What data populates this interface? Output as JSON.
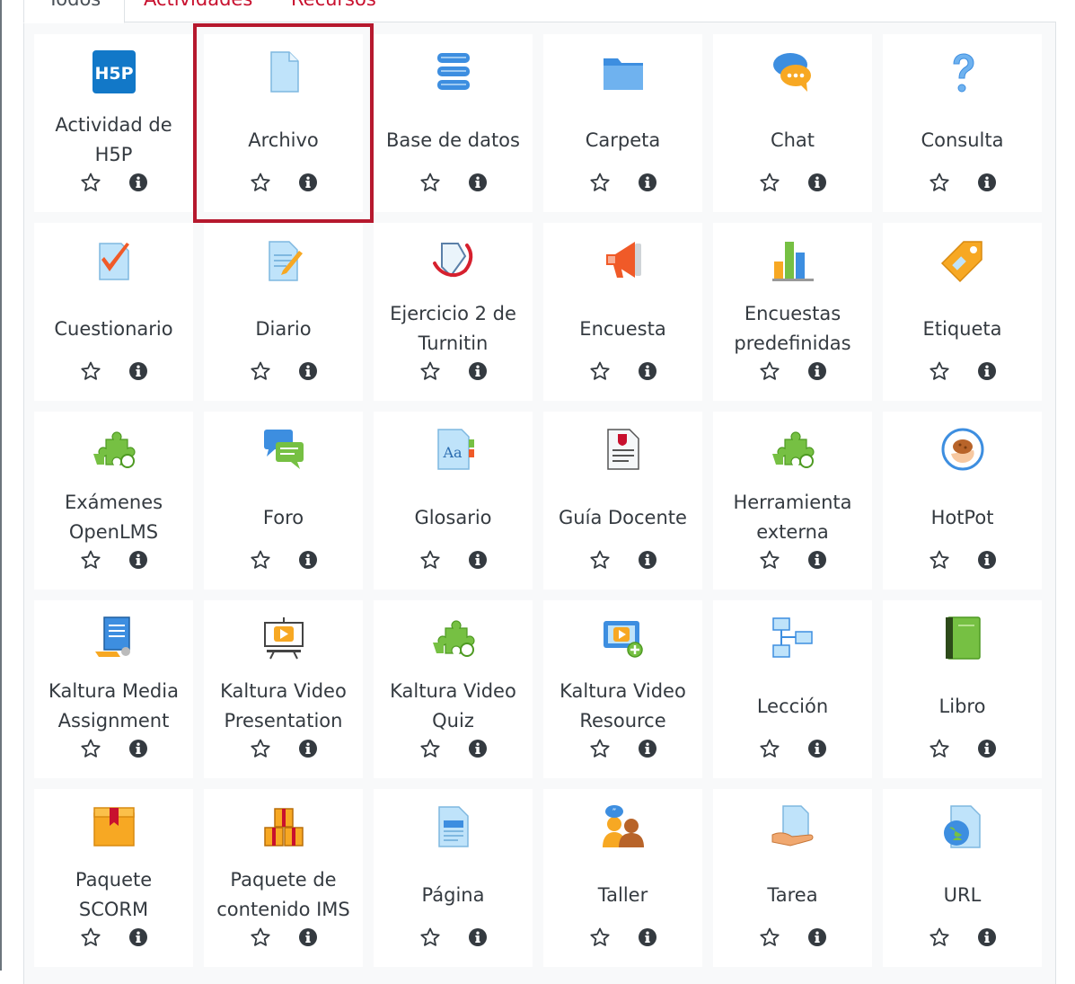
{
  "tabs": [
    {
      "label": "Todos",
      "active": true
    },
    {
      "label": "Actividades",
      "active": false
    },
    {
      "label": "Recursos",
      "active": false
    }
  ],
  "colors": {
    "accent": "#c8102e",
    "selection": "#b6192e",
    "text": "#343a40"
  },
  "items": [
    {
      "label": "Actividad de H5P",
      "icon": "h5p-icon",
      "selected": false
    },
    {
      "label": "Archivo",
      "icon": "file-icon",
      "selected": true
    },
    {
      "label": "Base de datos",
      "icon": "database-icon",
      "selected": false
    },
    {
      "label": "Carpeta",
      "icon": "folder-icon",
      "selected": false
    },
    {
      "label": "Chat",
      "icon": "chat-icon",
      "selected": false
    },
    {
      "label": "Consulta",
      "icon": "question-icon",
      "selected": false
    },
    {
      "label": "Cuestionario",
      "icon": "quiz-icon",
      "selected": false
    },
    {
      "label": "Diario",
      "icon": "journal-icon",
      "selected": false
    },
    {
      "label": "Ejercicio 2 de Turnitin",
      "icon": "turnitin-icon",
      "selected": false
    },
    {
      "label": "Encuesta",
      "icon": "megaphone-icon",
      "selected": false
    },
    {
      "label": "Encuestas predefinidas",
      "icon": "bar-chart-icon",
      "selected": false
    },
    {
      "label": "Etiqueta",
      "icon": "tag-icon",
      "selected": false
    },
    {
      "label": "Exámenes OpenLMS",
      "icon": "puzzle-icon",
      "selected": false
    },
    {
      "label": "Foro",
      "icon": "forum-icon",
      "selected": false
    },
    {
      "label": "Glosario",
      "icon": "glossary-icon",
      "selected": false
    },
    {
      "label": "Guía Docente",
      "icon": "document-seal-icon",
      "selected": false
    },
    {
      "label": "Herramienta externa",
      "icon": "puzzle-icon",
      "selected": false
    },
    {
      "label": "HotPot",
      "icon": "hotpot-icon",
      "selected": false
    },
    {
      "label": "Kaltura Media Assignment",
      "icon": "media-assignment-icon",
      "selected": false
    },
    {
      "label": "Kaltura Video Presentation",
      "icon": "video-presentation-icon",
      "selected": false
    },
    {
      "label": "Kaltura Video Quiz",
      "icon": "puzzle-icon",
      "selected": false
    },
    {
      "label": "Kaltura Video Resource",
      "icon": "video-resource-icon",
      "selected": false
    },
    {
      "label": "Lección",
      "icon": "lesson-icon",
      "selected": false
    },
    {
      "label": "Libro",
      "icon": "book-icon",
      "selected": false
    },
    {
      "label": "Paquete SCORM",
      "icon": "package-icon",
      "selected": false
    },
    {
      "label": "Paquete de contenido IMS",
      "icon": "boxes-icon",
      "selected": false
    },
    {
      "label": "Página",
      "icon": "page-icon",
      "selected": false
    },
    {
      "label": "Taller",
      "icon": "workshop-icon",
      "selected": false
    },
    {
      "label": "Tarea",
      "icon": "assignment-icon",
      "selected": false
    },
    {
      "label": "URL",
      "icon": "url-icon",
      "selected": false
    }
  ]
}
